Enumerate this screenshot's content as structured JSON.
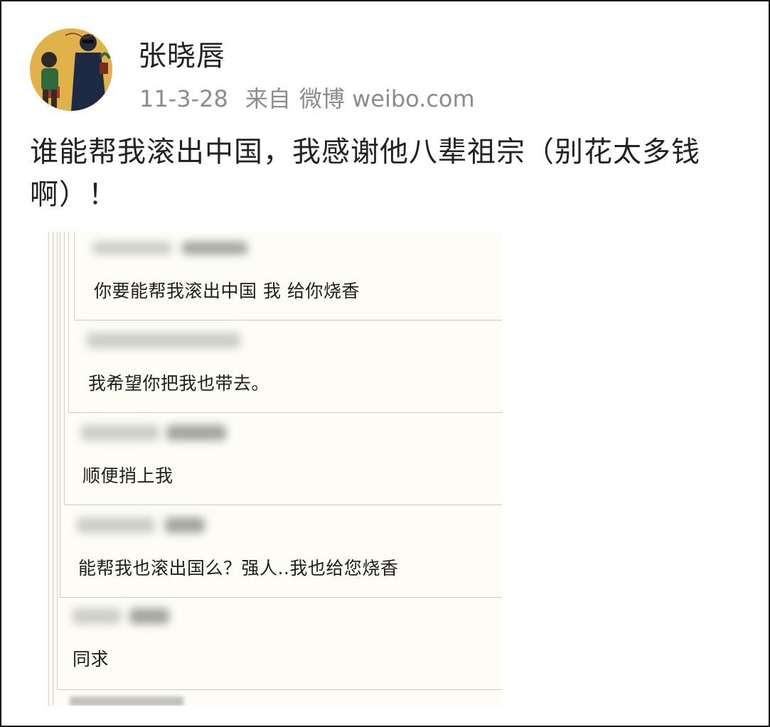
{
  "post": {
    "username": "张晓唇",
    "date": "11-3-28",
    "source_label": "来自",
    "source_name": "微博 weibo.com",
    "text": "谁能帮我滚出中国，我感谢他八辈祖宗（别花太多钱啊）！"
  },
  "screenshot": {
    "comments": [
      {
        "text": "你要能帮我滚出中国 我 给你烧香"
      },
      {
        "text": "我希望你把我也带去。"
      },
      {
        "text": "顺便捎上我"
      },
      {
        "text": "能帮我也滚出国么？强人..我也给您烧香"
      },
      {
        "text": "同求"
      }
    ]
  },
  "colors": {
    "username": "#222222",
    "meta": "#8c8c8c",
    "screenshot_bg": "#fdfdf6",
    "avatar_bg": "#e2b24a"
  },
  "icons": {
    "avatar": "leon-mathilda-avatar"
  }
}
